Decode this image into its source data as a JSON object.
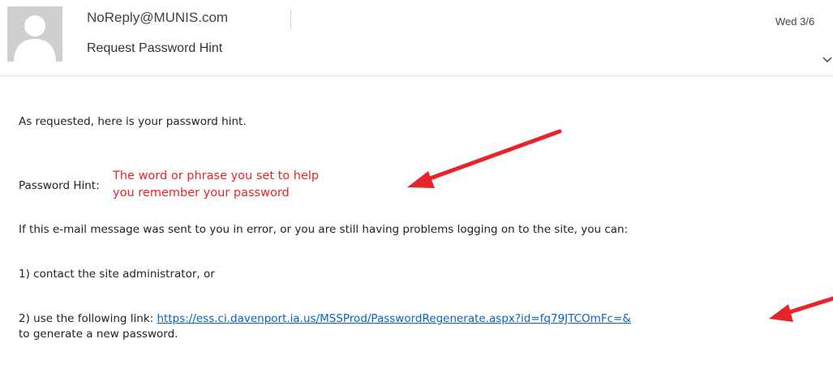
{
  "header": {
    "sender": "NoReply@MUNIS.com",
    "subject": "Request Password Hint",
    "date": "Wed 3/6"
  },
  "body": {
    "intro": "As requested, here is your password hint.",
    "hint_label": "Password Hint:",
    "hint_line1": "The word or phrase you set to help",
    "hint_line2": "you remember your password",
    "error_note": "If this e-mail message was sent to you in error, or you are still having problems logging on to the site, you can:",
    "option1": "1) contact the site administrator, or",
    "option2_prefix": "2) use the following link: ",
    "link_text": "https://ess.ci.davenport.ia.us/MSSProd/PasswordRegenerate.aspx?id=fq79JTCOmFc=&",
    "closing": "to generate a new password."
  },
  "colors": {
    "hint": "#e8232a",
    "link": "#0563c1",
    "arrow": "#e8232a"
  },
  "icons": {
    "avatar": "person-silhouette-icon",
    "expand": "chevron-down-icon"
  }
}
